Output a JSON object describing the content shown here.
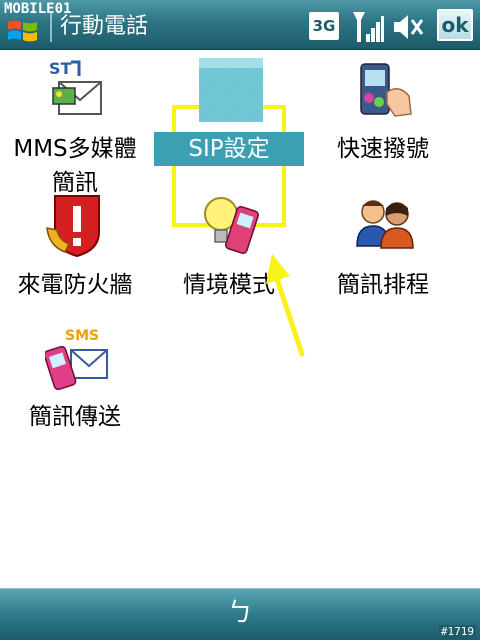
{
  "titlebar": {
    "watermark": "MOBILE01",
    "app_title": "行動電話",
    "status_3g": "3G",
    "ok_label": "ok"
  },
  "grid": {
    "items": [
      {
        "label_line1": "MMS多媒體",
        "label_line2": "簡訊",
        "icon": "mms-settings-icon"
      },
      {
        "label_line1": "SIP設定",
        "label_line2": "",
        "icon": "sip-settings-icon",
        "selected": true
      },
      {
        "label_line1": "快速撥號",
        "label_line2": "",
        "icon": "speed-dial-icon"
      },
      {
        "label_line1": "來電防火牆",
        "label_line2": "",
        "icon": "call-firewall-icon"
      },
      {
        "label_line1": "情境模式",
        "label_line2": "",
        "icon": "profiles-icon"
      },
      {
        "label_line1": "簡訊排程",
        "label_line2": "",
        "icon": "sms-schedule-icon"
      },
      {
        "label_line1": "簡訊傳送",
        "label_line2": "",
        "icon": "sms-send-icon",
        "badge": "SMS"
      }
    ]
  },
  "bottombar": {
    "softkey_center": "ㄅ",
    "photo_tag": "#1719"
  },
  "colors": {
    "bar_dark": "#1d5b69",
    "bar_light": "#4e99a8",
    "highlight_frame": "#f7f21a",
    "selection_bg": "#3d9fb3",
    "arrow": "#f7f21a"
  }
}
